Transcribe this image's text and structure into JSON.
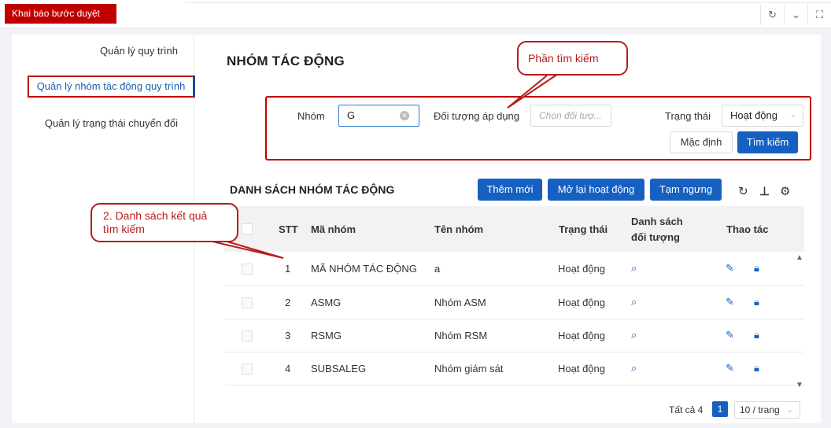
{
  "topbar": {
    "active_tab": "Khai báo bước duyệt",
    "icons": [
      "refresh-icon",
      "chevron-down-icon",
      "fullscreen-icon"
    ]
  },
  "sidebar": {
    "items": [
      {
        "label": "Quản lý quy trình"
      },
      {
        "label": "Quản lý nhóm tác động quy trình",
        "active": true
      },
      {
        "label": "Quản lý trạng thái chuyển đổi"
      }
    ]
  },
  "page": {
    "title": "NHÓM TÁC ĐỘNG"
  },
  "search": {
    "group_label": "Nhóm",
    "group_value": "G",
    "object_label": "Đối tượng áp dụng",
    "object_placeholder": "Chọn đối tượ...",
    "status_label": "Trạng thái",
    "status_value": "Hoạt động",
    "default_button": "Mặc định",
    "search_button": "Tìm kiếm"
  },
  "list": {
    "title": "DANH SÁCH NHÓM TÁC ĐỘNG",
    "add_button": "Thêm mới",
    "reactivate_button": "Mở lại hoạt động",
    "suspend_button": "Tạm ngưng"
  },
  "table": {
    "headers": {
      "stt": "STT",
      "code": "Mã nhóm",
      "name": "Tên nhóm",
      "status": "Trạng thái",
      "objects_line1": "Danh sách",
      "objects_line2": "đối tượng",
      "actions": "Thao tác"
    },
    "rows": [
      {
        "stt": "1",
        "code": "MÃ NHÓM TÁC ĐỘNG",
        "name": "a",
        "status": "Hoạt động"
      },
      {
        "stt": "2",
        "code": "ASMG",
        "name": "Nhóm ASM",
        "status": "Hoạt động"
      },
      {
        "stt": "3",
        "code": "RSMG",
        "name": "Nhóm RSM",
        "status": "Hoạt động"
      },
      {
        "stt": "4",
        "code": "SUBSALEG",
        "name": "Nhóm giám sát",
        "status": "Hoạt động"
      }
    ]
  },
  "pagination": {
    "total": "Tất cả 4",
    "current_page": "1",
    "page_size": "10 / trang"
  },
  "annotations": {
    "search_callout": "Phần tìm kiếm",
    "list_callout_line1": "2. Danh sách kết quả",
    "list_callout_line2": "tìm kiếm"
  },
  "colors": {
    "brand_red": "#c00000",
    "primary_blue": "#1660c2",
    "callout_red": "#b71c1c"
  }
}
